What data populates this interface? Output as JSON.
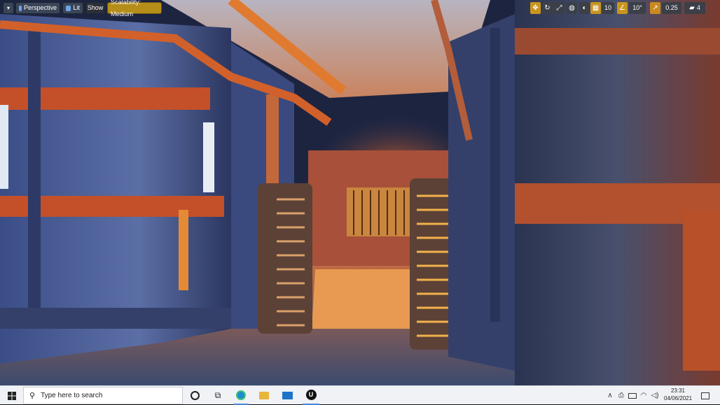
{
  "viewport": {
    "toolbar": {
      "menu_label": "▾",
      "perspective_label": "Perspective",
      "lit_label": "Lit",
      "show_label": "Show",
      "scalability_label": "Scalability: Medium"
    },
    "right_toolbar": {
      "grid_snap_value": "10",
      "rotation_snap_value": "10°",
      "scale_snap_value": "0.25",
      "camera_speed_value": "4"
    },
    "scene_description_icon": "ue4-level-viewport"
  },
  "taskbar": {
    "search_placeholder": "Type here to search",
    "time": "23:31",
    "date": "04/06/2021",
    "apps": [
      "cortana-icon",
      "task-view-icon",
      "edge-icon",
      "file-explorer-icon",
      "mail-icon",
      "unreal-engine-icon"
    ]
  },
  "colors": {
    "accent_gold": "#c9951d",
    "taskbar_bg": "#f0f2f5"
  }
}
